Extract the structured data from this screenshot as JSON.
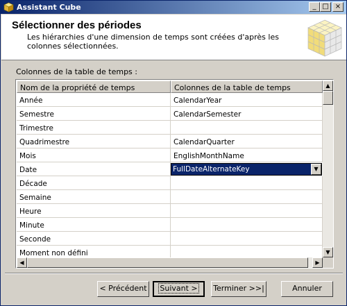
{
  "window": {
    "title": "Assistant Cube"
  },
  "header": {
    "title": "Sélectionner des périodes",
    "description": "Les hiérarchies d'une dimension de temps sont créées d'après les colonnes sélectionnées."
  },
  "grid": {
    "label": "Colonnes de la table de temps :",
    "columns": [
      "Nom de la propriété de temps",
      "Colonnes de la table de temps"
    ],
    "rows": [
      {
        "name": "Année",
        "column": "CalendarYear"
      },
      {
        "name": "Semestre",
        "column": "CalendarSemester"
      },
      {
        "name": "Trimestre",
        "column": ""
      },
      {
        "name": "Quadrimestre",
        "column": "CalendarQuarter"
      },
      {
        "name": "Mois",
        "column": "EnglishMonthName"
      },
      {
        "name": "Date",
        "column": "FullDateAlternateKey",
        "selected": true
      },
      {
        "name": "Décade",
        "column": ""
      },
      {
        "name": "Semaine",
        "column": ""
      },
      {
        "name": "Heure",
        "column": ""
      },
      {
        "name": "Minute",
        "column": ""
      },
      {
        "name": "Seconde",
        "column": ""
      },
      {
        "name": "Moment non défini",
        "column": ""
      }
    ]
  },
  "buttons": {
    "back": "< Précédent",
    "next": "Suivant >",
    "finish": "Terminer >>|",
    "cancel": "Annuler"
  },
  "titlebar_buttons": {
    "minimize": "_",
    "maximize": "□",
    "close": "×"
  },
  "colors": {
    "title_start": "#0a246a",
    "title_end": "#a6caf0",
    "face": "#d4d0c8",
    "selection": "#0a246a"
  }
}
